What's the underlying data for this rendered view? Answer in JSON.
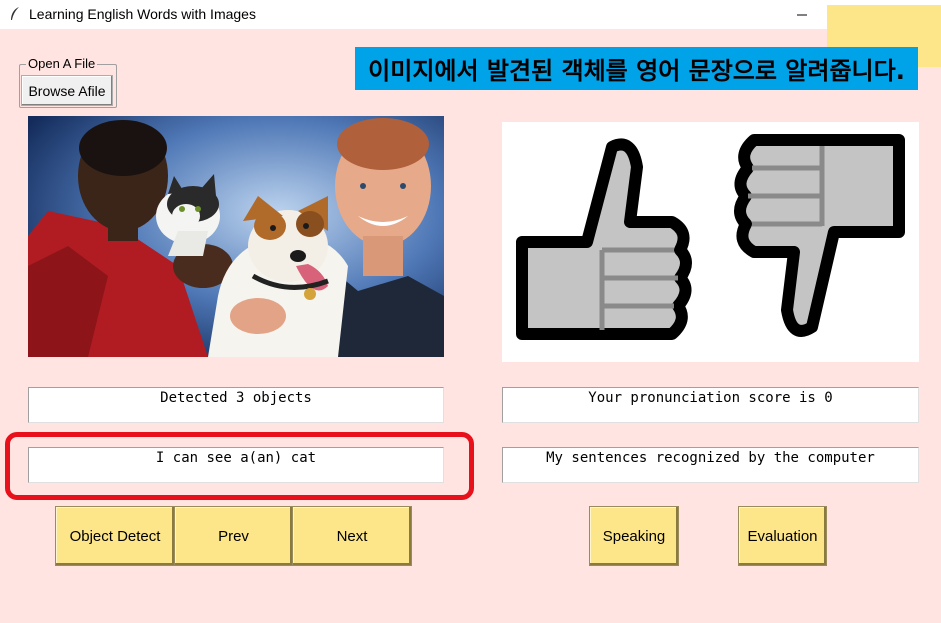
{
  "window": {
    "title": "Learning English Words with Images",
    "controls": {
      "minimize": "—",
      "maximize": "☐",
      "close": "✕"
    }
  },
  "file_frame": {
    "legend": "Open A File",
    "browse_label": "Browse Afile"
  },
  "banner": {
    "text": "이미지에서 발견된 객체를 영어 문장으로 알려줍니다."
  },
  "images": {
    "photo_icon": "people-with-pets-photo",
    "thumbs_icon": "thumbs-up-down-icon"
  },
  "outputs": {
    "detected": "Detected 3 objects",
    "score": "Your pronunciation score is 0",
    "sentence": "I can see a(an) cat",
    "recognized": "My sentences recognized by the computer"
  },
  "buttons": {
    "object_detect": "Object Detect",
    "prev": "Prev",
    "next": "Next",
    "speaking": "Speaking",
    "evaluation": "Evaluation"
  },
  "colors": {
    "background": "#ffe4e1",
    "button": "#fde68a",
    "banner": "#00a2e8",
    "highlight": "#e8101a"
  }
}
